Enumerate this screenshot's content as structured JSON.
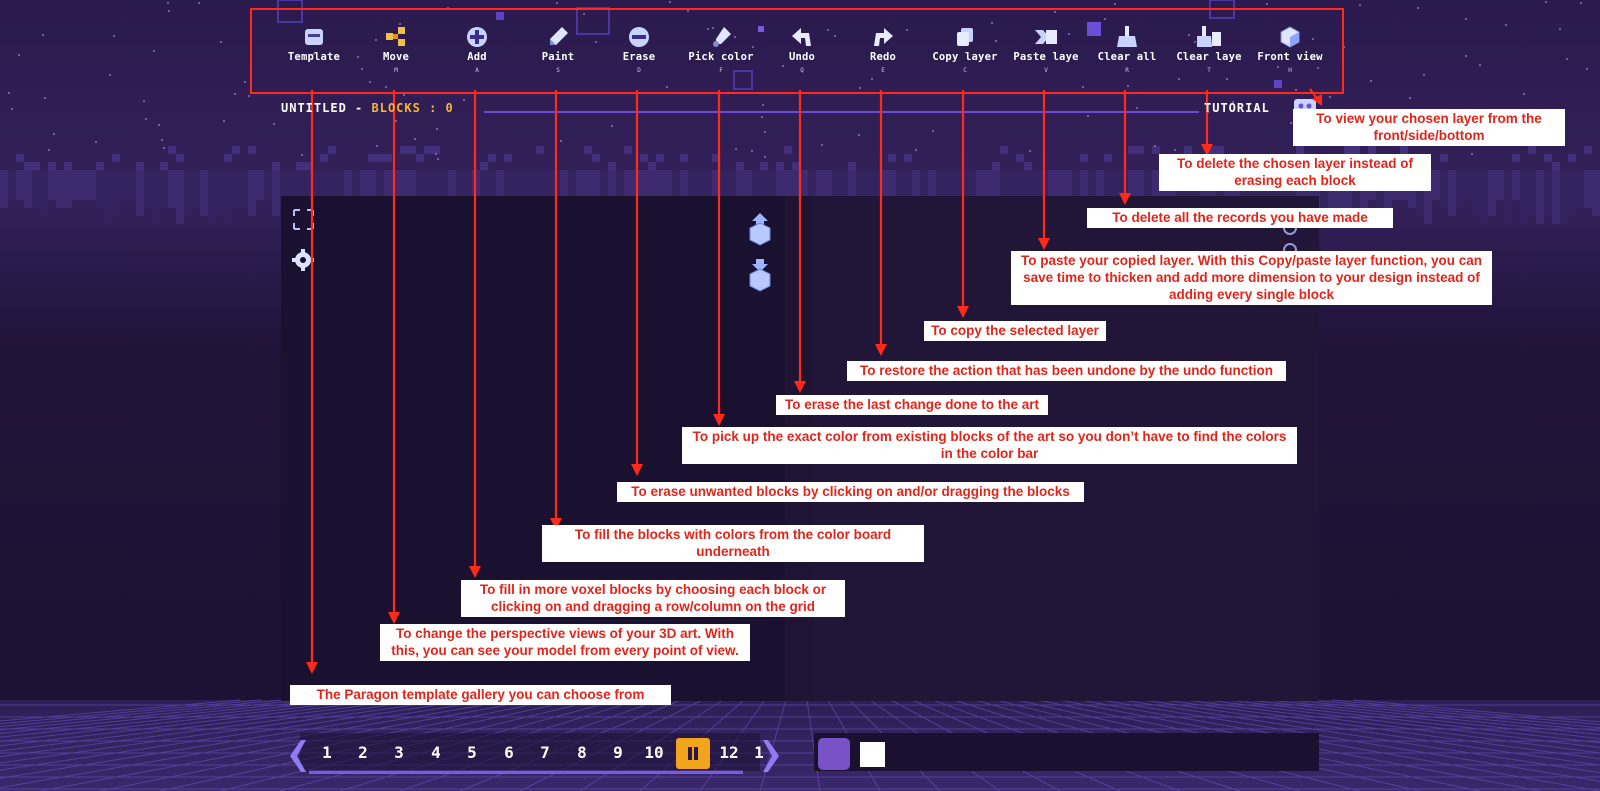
{
  "toolbar": {
    "tools": [
      {
        "label": "Template",
        "key": ""
      },
      {
        "label": "Move",
        "key": "M"
      },
      {
        "label": "Add",
        "key": "A"
      },
      {
        "label": "Paint",
        "key": "S"
      },
      {
        "label": "Erase",
        "key": "D"
      },
      {
        "label": "Pick color",
        "key": "F"
      },
      {
        "label": "Undo",
        "key": "Q"
      },
      {
        "label": "Redo",
        "key": "E"
      },
      {
        "label": "Copy layer",
        "key": "C"
      },
      {
        "label": "Paste laye",
        "key": "V"
      },
      {
        "label": "Clear all",
        "key": "R"
      },
      {
        "label": "Clear laye",
        "key": "T"
      },
      {
        "label": "Front view",
        "key": "H"
      }
    ]
  },
  "header": {
    "title": "UNTITLED",
    "separator": "-",
    "blocks_label": "BLOCKS : 0",
    "tutorial": "TUTORIAL"
  },
  "callouts": {
    "front_view": "To view your chosen layer from the front/side/bottom",
    "clear_layer": "To delete the chosen layer instead of erasing each block",
    "clear_all": "To delete all the records you have made",
    "paste_layer": "To paste your copied layer. With this Copy/paste layer function, you can save time to thicken and add more dimension to your design instead of adding every single block",
    "copy_layer": "To copy the selected layer",
    "redo": "To restore the action that has been undone by the undo function",
    "undo": "To erase the last change done to the art",
    "pick_color": "To pick up the exact color from existing blocks of the art so you don’t have to find the colors in the color bar",
    "erase": "To erase unwanted blocks by clicking on and/or dragging the blocks",
    "paint": "To fill the blocks with colors from the color board underneath",
    "add": "To fill in more voxel blocks by choosing each block or clicking on and dragging a row/column on the grid",
    "move": "To change the perspective views of your 3D art. With this, you can see your model from every point of view.",
    "template": "The Paragon template gallery you can choose from"
  },
  "pager": {
    "pages": [
      "1",
      "2",
      "3",
      "4",
      "5",
      "6",
      "7",
      "8",
      "9",
      "10",
      "12",
      "1"
    ]
  },
  "colors": {
    "accent": "#ff2a1a",
    "background": "#241640",
    "panel": "#1a1030",
    "highlight": "#f2a41d",
    "callout_text": "#e1251b"
  }
}
